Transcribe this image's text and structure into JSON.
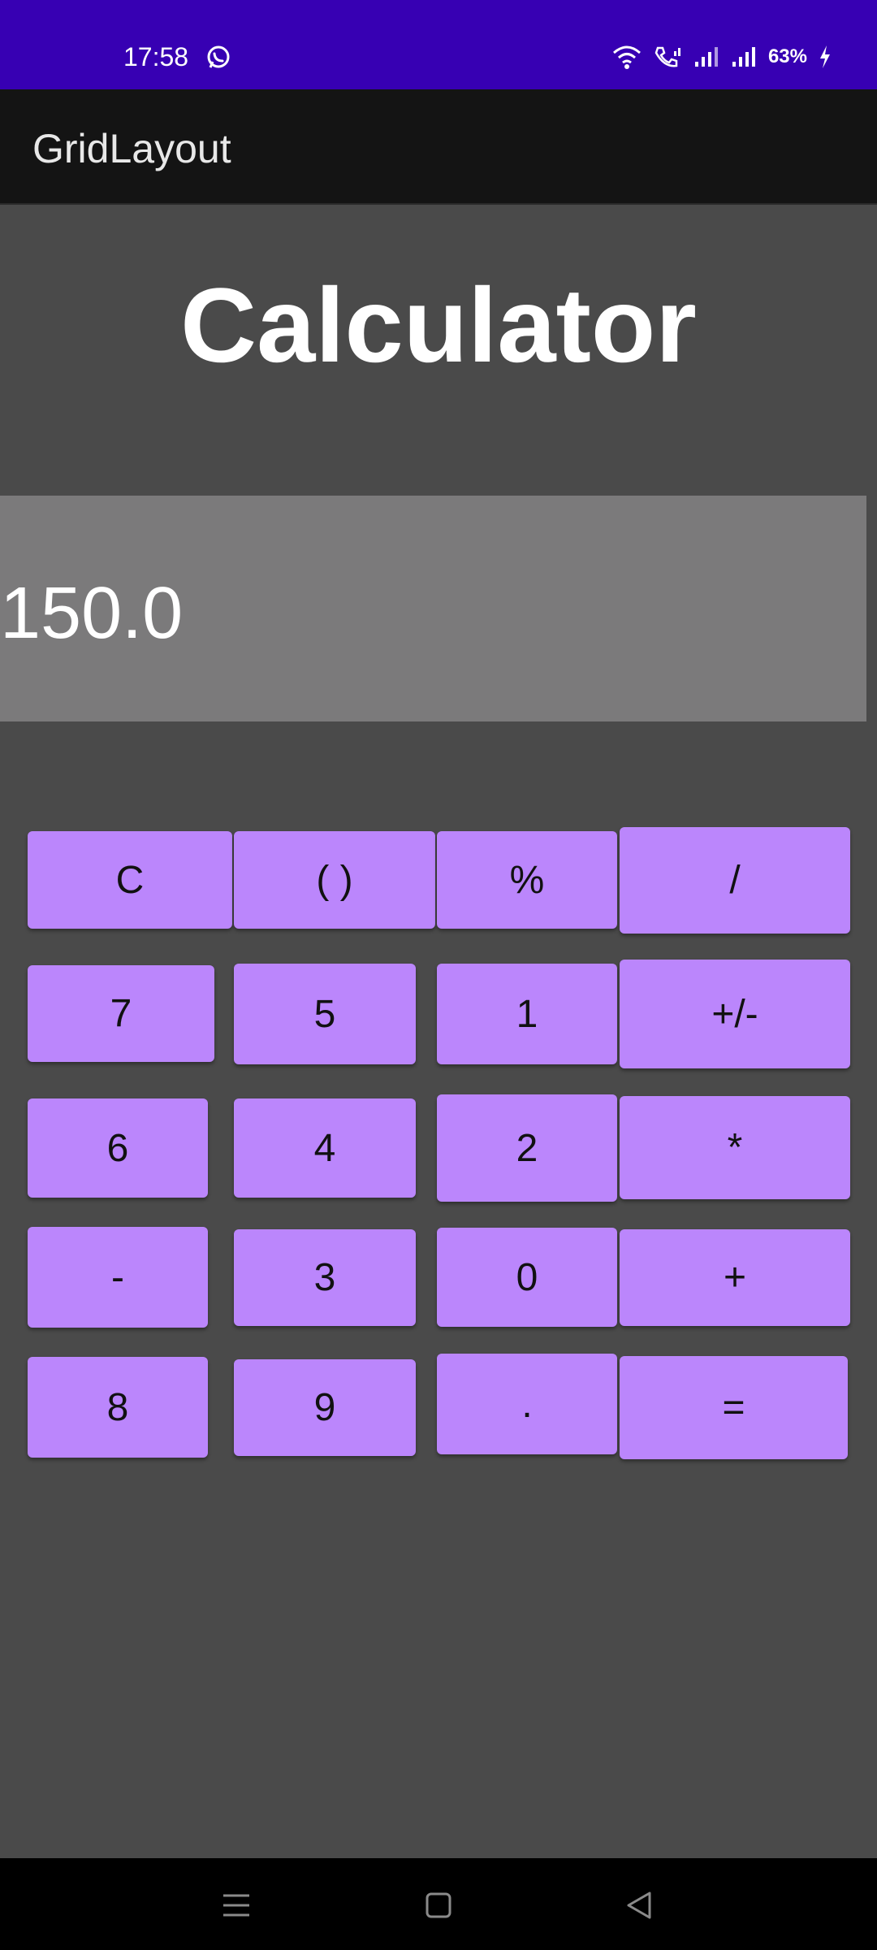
{
  "status_bar": {
    "time": "17:58",
    "battery": "63%",
    "background": "#3700b3"
  },
  "app_bar": {
    "title": "GridLayout"
  },
  "main": {
    "heading": "Calculator",
    "display_value": "150.0"
  },
  "keypad": {
    "accent": "#bb86fc",
    "keys": {
      "clear": "C",
      "parentheses": "( )",
      "percent": "%",
      "divide": "/",
      "seven": "7",
      "five": "5",
      "one": "1",
      "sign": "+/-",
      "six": "6",
      "four": "4",
      "two": "2",
      "multiply": "*",
      "minus": "-",
      "three": "3",
      "zero": "0",
      "plus": "+",
      "eight": "8",
      "nine": "9",
      "decimal": ".",
      "equals": "="
    }
  },
  "nav_bar": {
    "icons": [
      "menu-icon",
      "home-icon",
      "back-icon"
    ]
  }
}
